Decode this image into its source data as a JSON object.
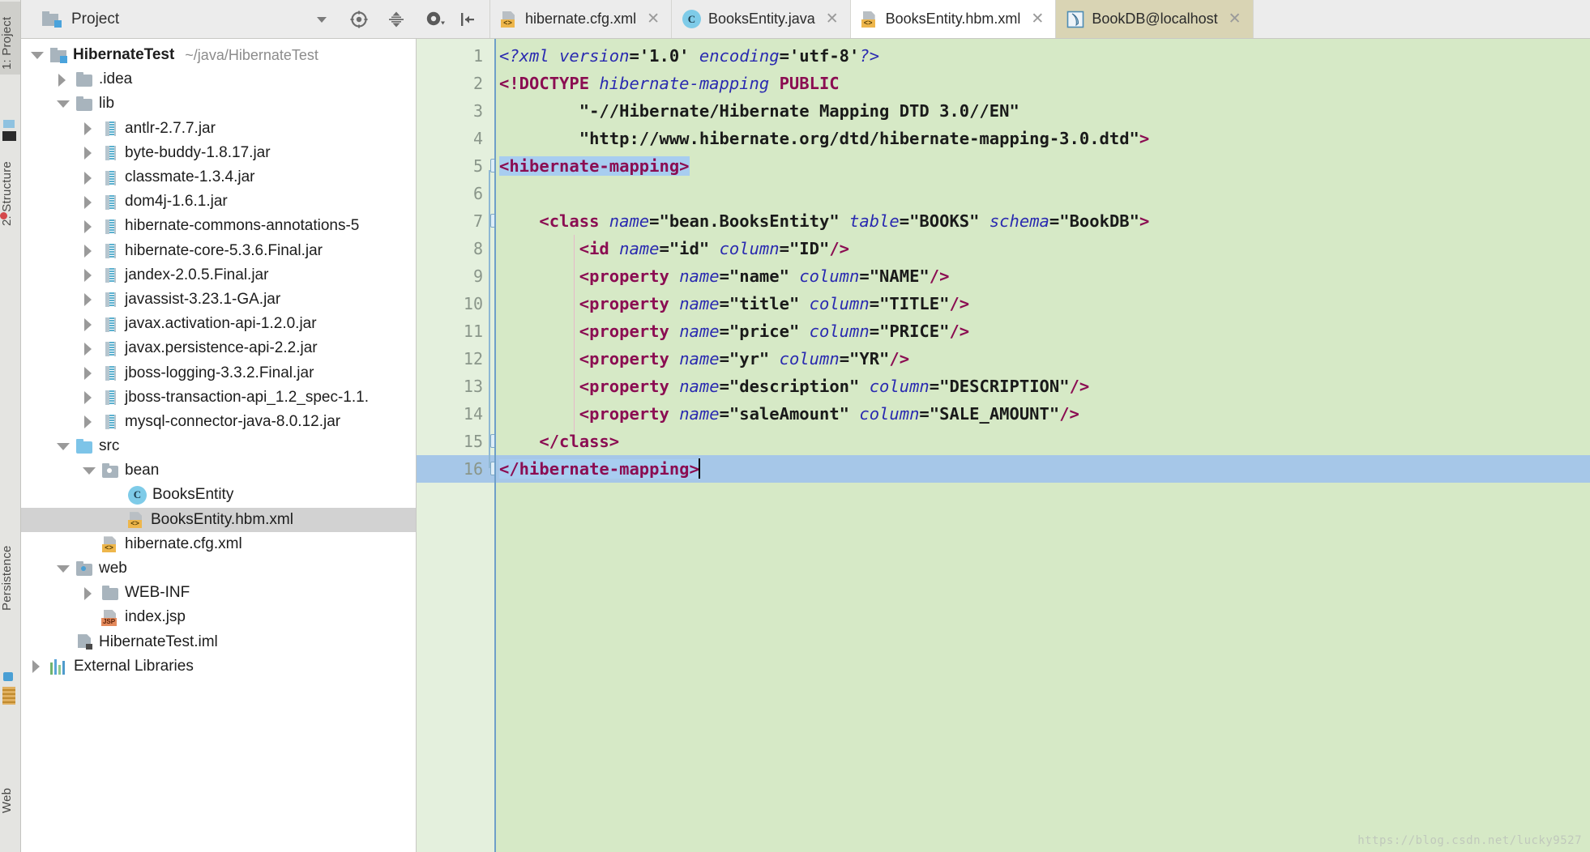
{
  "project_panel": {
    "title": "Project",
    "icon": "project-view-icon",
    "tools": [
      {
        "name": "view-options-dropdown",
        "glyph": "▼"
      },
      {
        "name": "scroll-from-source-icon",
        "glyph": "⊕"
      },
      {
        "name": "collapse-all-icon",
        "glyph": "⇵"
      }
    ]
  },
  "left_rail": {
    "buttons": [
      {
        "label": "1: Project",
        "selected": true
      },
      {
        "label": "2: Structure",
        "selected": false
      },
      {
        "label": "Persistence",
        "selected": false
      },
      {
        "label": "Web",
        "selected": false
      }
    ]
  },
  "editor_tabs": {
    "tools": [
      {
        "name": "settings-gear-icon",
        "glyph": "⚙"
      },
      {
        "name": "hide-panel-icon",
        "glyph": "⇤"
      }
    ],
    "tabs": [
      {
        "label": "hibernate.cfg.xml",
        "icon": "xml-file-icon",
        "active": false,
        "style": "normal",
        "closable": true
      },
      {
        "label": "BooksEntity.java",
        "icon": "java-class-icon",
        "active": false,
        "style": "normal",
        "closable": true
      },
      {
        "label": "BooksEntity.hbm.xml",
        "icon": "xml-file-icon",
        "active": true,
        "style": "normal",
        "closable": true
      },
      {
        "label": "BookDB@localhost",
        "icon": "database-icon",
        "active": false,
        "style": "db",
        "closable": true
      }
    ]
  },
  "tree": [
    {
      "depth": 0,
      "twisty": "down",
      "icon": "project-icon",
      "label": "HibernateTest",
      "bold": true,
      "path": "~/java/HibernateTest",
      "selected": false
    },
    {
      "depth": 1,
      "twisty": "right",
      "icon": "folder-icon",
      "label": ".idea",
      "selected": false
    },
    {
      "depth": 1,
      "twisty": "down",
      "icon": "folder-icon",
      "label": "lib",
      "selected": false
    },
    {
      "depth": 2,
      "twisty": "right",
      "icon": "jar-icon",
      "label": "antlr-2.7.7.jar",
      "selected": false
    },
    {
      "depth": 2,
      "twisty": "right",
      "icon": "jar-icon",
      "label": "byte-buddy-1.8.17.jar",
      "selected": false
    },
    {
      "depth": 2,
      "twisty": "right",
      "icon": "jar-icon",
      "label": "classmate-1.3.4.jar",
      "selected": false
    },
    {
      "depth": 2,
      "twisty": "right",
      "icon": "jar-icon",
      "label": "dom4j-1.6.1.jar",
      "selected": false
    },
    {
      "depth": 2,
      "twisty": "right",
      "icon": "jar-icon",
      "label": "hibernate-commons-annotations-5",
      "selected": false
    },
    {
      "depth": 2,
      "twisty": "right",
      "icon": "jar-icon",
      "label": "hibernate-core-5.3.6.Final.jar",
      "selected": false
    },
    {
      "depth": 2,
      "twisty": "right",
      "icon": "jar-icon",
      "label": "jandex-2.0.5.Final.jar",
      "selected": false
    },
    {
      "depth": 2,
      "twisty": "right",
      "icon": "jar-icon",
      "label": "javassist-3.23.1-GA.jar",
      "selected": false
    },
    {
      "depth": 2,
      "twisty": "right",
      "icon": "jar-icon",
      "label": "javax.activation-api-1.2.0.jar",
      "selected": false
    },
    {
      "depth": 2,
      "twisty": "right",
      "icon": "jar-icon",
      "label": "javax.persistence-api-2.2.jar",
      "selected": false
    },
    {
      "depth": 2,
      "twisty": "right",
      "icon": "jar-icon",
      "label": "jboss-logging-3.3.2.Final.jar",
      "selected": false
    },
    {
      "depth": 2,
      "twisty": "right",
      "icon": "jar-icon",
      "label": "jboss-transaction-api_1.2_spec-1.1.",
      "selected": false
    },
    {
      "depth": 2,
      "twisty": "right",
      "icon": "jar-icon",
      "label": "mysql-connector-java-8.0.12.jar",
      "selected": false
    },
    {
      "depth": 1,
      "twisty": "down",
      "icon": "source-folder-icon",
      "label": "src",
      "selected": false
    },
    {
      "depth": 2,
      "twisty": "down",
      "icon": "package-icon",
      "label": "bean",
      "selected": false
    },
    {
      "depth": 3,
      "twisty": "none",
      "icon": "java-class-icon",
      "label": "BooksEntity",
      "selected": false
    },
    {
      "depth": 3,
      "twisty": "none",
      "icon": "xml-file-icon",
      "label": "BooksEntity.hbm.xml",
      "selected": true
    },
    {
      "depth": 2,
      "twisty": "none",
      "icon": "xml-file-icon",
      "label": "hibernate.cfg.xml",
      "selected": false
    },
    {
      "depth": 1,
      "twisty": "down",
      "icon": "web-folder-icon",
      "label": "web",
      "selected": false
    },
    {
      "depth": 2,
      "twisty": "right",
      "icon": "folder-icon",
      "label": "WEB-INF",
      "selected": false
    },
    {
      "depth": 2,
      "twisty": "none",
      "icon": "jsp-file-icon",
      "label": "index.jsp",
      "selected": false
    },
    {
      "depth": 1,
      "twisty": "none",
      "icon": "iml-file-icon",
      "label": "HibernateTest.iml",
      "selected": false
    },
    {
      "depth": 0,
      "twisty": "right",
      "icon": "external-libraries-icon",
      "label": "External Libraries",
      "selected": false
    }
  ],
  "editor": {
    "filename": "BooksEntity.hbm.xml",
    "line_numbers": [
      1,
      2,
      3,
      4,
      5,
      6,
      7,
      8,
      9,
      10,
      11,
      12,
      13,
      14,
      15,
      16
    ],
    "current_line": 16,
    "caret_line": 16,
    "lines": [
      {
        "n": 1,
        "indent": 0,
        "tokens": [
          {
            "t": "pi",
            "s": "<?xml "
          },
          {
            "t": "attr",
            "s": "version"
          },
          {
            "t": "punct",
            "s": "="
          },
          {
            "t": "val",
            "s": "'1.0'"
          },
          {
            "t": "plain",
            "s": " "
          },
          {
            "t": "attr",
            "s": "encoding"
          },
          {
            "t": "punct",
            "s": "="
          },
          {
            "t": "val",
            "s": "'utf-8'"
          },
          {
            "t": "pi",
            "s": "?>"
          }
        ]
      },
      {
        "n": 2,
        "indent": 0,
        "tokens": [
          {
            "t": "dtd",
            "s": "<!DOCTYPE "
          },
          {
            "t": "dtdname",
            "s": "hibernate-mapping"
          },
          {
            "t": "plain",
            "s": " "
          },
          {
            "t": "dtd",
            "s": "PUBLIC"
          }
        ]
      },
      {
        "n": 3,
        "indent": 2,
        "tokens": [
          {
            "t": "val",
            "s": "\"-//Hibernate/Hibernate Mapping DTD 3.0//EN\""
          }
        ]
      },
      {
        "n": 4,
        "indent": 2,
        "tokens": [
          {
            "t": "val",
            "s": "\"http://www.hibernate.org/dtd/hibernate-mapping-3.0.dtd\""
          },
          {
            "t": "dtd",
            "s": ">"
          }
        ]
      },
      {
        "n": 5,
        "indent": 0,
        "fold": "minus",
        "tokens": [
          {
            "t": "tag",
            "s": "<hibernate-mapping>",
            "hl": true
          }
        ]
      },
      {
        "n": 6,
        "indent": 0,
        "tokens": []
      },
      {
        "n": 7,
        "indent": 1,
        "fold": "minus",
        "tokens": [
          {
            "t": "tag",
            "s": "<class"
          },
          {
            "t": "plain",
            "s": " "
          },
          {
            "t": "attr",
            "s": "name"
          },
          {
            "t": "punct",
            "s": "="
          },
          {
            "t": "val",
            "s": "\"bean.BooksEntity\""
          },
          {
            "t": "plain",
            "s": " "
          },
          {
            "t": "attr",
            "s": "table"
          },
          {
            "t": "punct",
            "s": "="
          },
          {
            "t": "val",
            "s": "\"BOOKS\""
          },
          {
            "t": "plain",
            "s": " "
          },
          {
            "t": "attr",
            "s": "schema"
          },
          {
            "t": "punct",
            "s": "="
          },
          {
            "t": "val",
            "s": "\"BookDB\""
          },
          {
            "t": "tag",
            "s": ">"
          }
        ]
      },
      {
        "n": 8,
        "indent": 2,
        "tokens": [
          {
            "t": "tag",
            "s": "<id"
          },
          {
            "t": "plain",
            "s": " "
          },
          {
            "t": "attr",
            "s": "name"
          },
          {
            "t": "punct",
            "s": "="
          },
          {
            "t": "val",
            "s": "\"id\""
          },
          {
            "t": "plain",
            "s": " "
          },
          {
            "t": "attr",
            "s": "column"
          },
          {
            "t": "punct",
            "s": "="
          },
          {
            "t": "val",
            "s": "\"ID\""
          },
          {
            "t": "tag",
            "s": "/>"
          }
        ]
      },
      {
        "n": 9,
        "indent": 2,
        "tokens": [
          {
            "t": "tag",
            "s": "<property"
          },
          {
            "t": "plain",
            "s": " "
          },
          {
            "t": "attr",
            "s": "name"
          },
          {
            "t": "punct",
            "s": "="
          },
          {
            "t": "val",
            "s": "\"name\""
          },
          {
            "t": "plain",
            "s": " "
          },
          {
            "t": "attr",
            "s": "column"
          },
          {
            "t": "punct",
            "s": "="
          },
          {
            "t": "val",
            "s": "\"NAME\""
          },
          {
            "t": "tag",
            "s": "/>"
          }
        ]
      },
      {
        "n": 10,
        "indent": 2,
        "tokens": [
          {
            "t": "tag",
            "s": "<property"
          },
          {
            "t": "plain",
            "s": " "
          },
          {
            "t": "attr",
            "s": "name"
          },
          {
            "t": "punct",
            "s": "="
          },
          {
            "t": "val",
            "s": "\"title\""
          },
          {
            "t": "plain",
            "s": " "
          },
          {
            "t": "attr",
            "s": "column"
          },
          {
            "t": "punct",
            "s": "="
          },
          {
            "t": "val",
            "s": "\"TITLE\""
          },
          {
            "t": "tag",
            "s": "/>"
          }
        ]
      },
      {
        "n": 11,
        "indent": 2,
        "tokens": [
          {
            "t": "tag",
            "s": "<property"
          },
          {
            "t": "plain",
            "s": " "
          },
          {
            "t": "attr",
            "s": "name"
          },
          {
            "t": "punct",
            "s": "="
          },
          {
            "t": "val",
            "s": "\"price\""
          },
          {
            "t": "plain",
            "s": " "
          },
          {
            "t": "attr",
            "s": "column"
          },
          {
            "t": "punct",
            "s": "="
          },
          {
            "t": "val",
            "s": "\"PRICE\""
          },
          {
            "t": "tag",
            "s": "/>"
          }
        ]
      },
      {
        "n": 12,
        "indent": 2,
        "tokens": [
          {
            "t": "tag",
            "s": "<property"
          },
          {
            "t": "plain",
            "s": " "
          },
          {
            "t": "attr",
            "s": "name"
          },
          {
            "t": "punct",
            "s": "="
          },
          {
            "t": "val",
            "s": "\"yr\""
          },
          {
            "t": "plain",
            "s": " "
          },
          {
            "t": "attr",
            "s": "column"
          },
          {
            "t": "punct",
            "s": "="
          },
          {
            "t": "val",
            "s": "\"YR\""
          },
          {
            "t": "tag",
            "s": "/>"
          }
        ]
      },
      {
        "n": 13,
        "indent": 2,
        "tokens": [
          {
            "t": "tag",
            "s": "<property"
          },
          {
            "t": "plain",
            "s": " "
          },
          {
            "t": "attr",
            "s": "name"
          },
          {
            "t": "punct",
            "s": "="
          },
          {
            "t": "val",
            "s": "\"description\""
          },
          {
            "t": "plain",
            "s": " "
          },
          {
            "t": "attr",
            "s": "column"
          },
          {
            "t": "punct",
            "s": "="
          },
          {
            "t": "val",
            "s": "\"DESCRIPTION\""
          },
          {
            "t": "tag",
            "s": "/>"
          }
        ]
      },
      {
        "n": 14,
        "indent": 2,
        "tokens": [
          {
            "t": "tag",
            "s": "<property"
          },
          {
            "t": "plain",
            "s": " "
          },
          {
            "t": "attr",
            "s": "name"
          },
          {
            "t": "punct",
            "s": "="
          },
          {
            "t": "val",
            "s": "\"saleAmount\""
          },
          {
            "t": "plain",
            "s": " "
          },
          {
            "t": "attr",
            "s": "column"
          },
          {
            "t": "punct",
            "s": "="
          },
          {
            "t": "val",
            "s": "\"SALE_AMOUNT\""
          },
          {
            "t": "tag",
            "s": "/>"
          }
        ]
      },
      {
        "n": 15,
        "indent": 1,
        "fold": "minus-end",
        "tokens": [
          {
            "t": "tag",
            "s": "</class>"
          }
        ]
      },
      {
        "n": 16,
        "indent": 0,
        "fold": "minus-end",
        "current": true,
        "caret": true,
        "tokens": [
          {
            "t": "tag",
            "s": "</hibernate-mapping>",
            "hl": true
          }
        ]
      }
    ],
    "watermark": "https://blog.csdn.net/lucky9527"
  },
  "colors": {
    "editor_background": "#d6e9c6",
    "gutter_background": "#e4f0dd",
    "current_line": "#a6c7e8",
    "tag": "#8b0d52",
    "attribute": "#2a2ab0",
    "value": "#1a1a1a",
    "selection_highlight": "#a8cdf0",
    "tree_selection": "#d2d2d2",
    "db_tab": "#d9d4b4"
  }
}
